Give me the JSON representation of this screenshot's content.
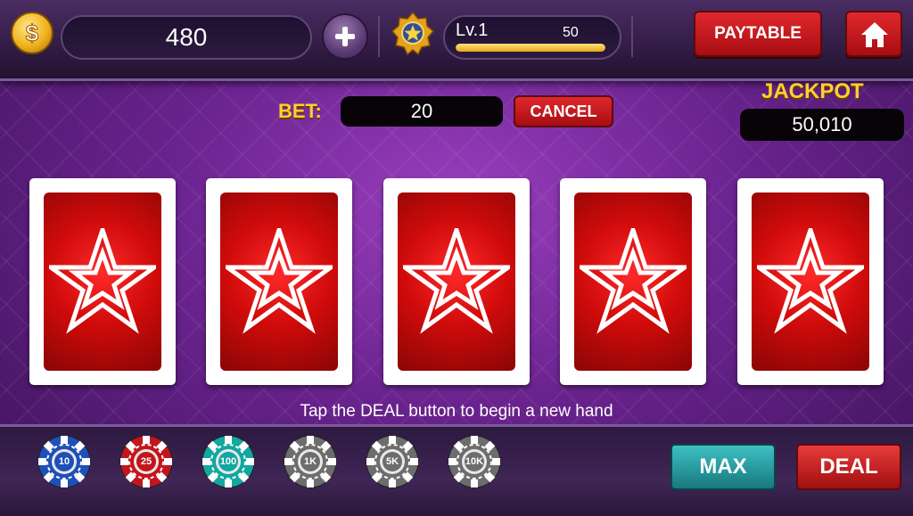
{
  "header": {
    "balance": "480",
    "level_label": "Lv.1",
    "level_value": "50",
    "level_progress_fraction": 1.0,
    "paytable_label": "PAYTABLE",
    "icons": [
      "dollar-coin-icon",
      "plus-icon",
      "star-badge-icon",
      "home-icon"
    ]
  },
  "bet": {
    "label": "BET:",
    "value": "20",
    "cancel_label": "CANCEL"
  },
  "jackpot": {
    "label": "JACKPOT",
    "value": "50,010"
  },
  "cards": [
    {
      "face": "back",
      "icon": "star-icon"
    },
    {
      "face": "back",
      "icon": "star-icon"
    },
    {
      "face": "back",
      "icon": "star-icon"
    },
    {
      "face": "back",
      "icon": "star-icon"
    },
    {
      "face": "back",
      "icon": "star-icon"
    }
  ],
  "hint": "Tap the DEAL button to begin a new hand",
  "chips": [
    {
      "label": "10",
      "color": "#1f4fb8"
    },
    {
      "label": "25",
      "color": "#c4151c"
    },
    {
      "label": "100",
      "color": "#12a7a0"
    },
    {
      "label": "1K",
      "color": "#6d6d6d"
    },
    {
      "label": "5K",
      "color": "#6d6d6d"
    },
    {
      "label": "10K",
      "color": "#6d6d6d"
    }
  ],
  "controls": {
    "max_label": "MAX",
    "deal_label": "DEAL"
  }
}
